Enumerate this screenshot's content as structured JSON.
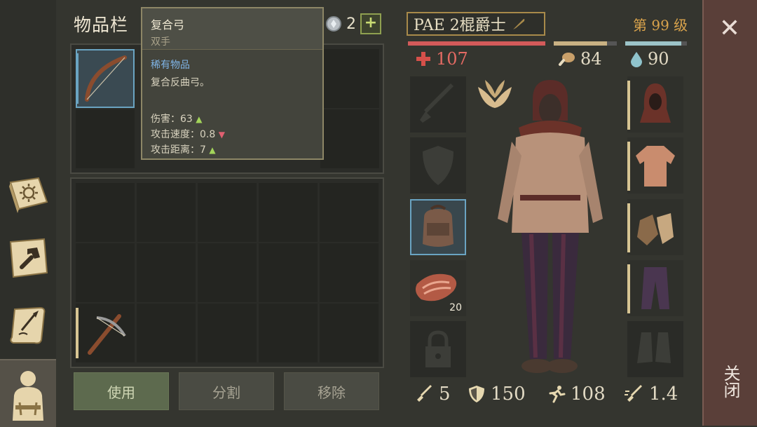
{
  "inventory": {
    "title": "物品栏",
    "currency_amount": "2",
    "add_label": "+"
  },
  "tooltip": {
    "item_name": "复合弓",
    "hand_type": "双手",
    "rarity": "稀有物品",
    "description": "复合反曲弓。",
    "stats": [
      {
        "label": "伤害：",
        "value": "63",
        "trend": "up"
      },
      {
        "label": "攻击速度：",
        "value": "0.8",
        "trend": "down"
      },
      {
        "label": "攻击距离：",
        "value": "7",
        "trend": "up"
      }
    ]
  },
  "actions": {
    "use": "使用",
    "split": "分割",
    "remove": "移除"
  },
  "character": {
    "name": "PAE 2棍爵士",
    "level": "第 99 级",
    "health": "107",
    "food": "84",
    "water": "90",
    "left_slot_item_count": "20",
    "attack": "5",
    "armor": "150",
    "speed": "108",
    "attack_speed": "1.4"
  },
  "close": {
    "label": "关闭"
  },
  "colors": {
    "health_bar": "#d35a5a",
    "food_bar": "#c9b183",
    "water_bar": "#9cc4c8",
    "level": "#d9a34c",
    "rarity": "#7fb4e6",
    "close_panel": "#5a3f39"
  },
  "icons": {
    "sidebar": [
      "skills-book-icon",
      "crafting-hammer-icon",
      "quest-scroll-icon",
      "character-icon"
    ],
    "health": "health-cross-icon",
    "food": "drumstick-icon",
    "water": "water-drop-icon"
  }
}
